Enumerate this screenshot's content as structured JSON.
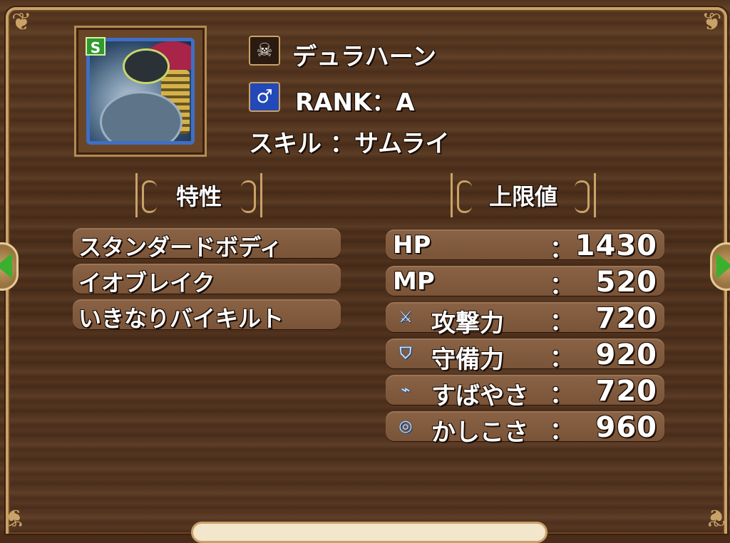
{
  "monster": {
    "name": "デュラハーン",
    "name_icon": "skull-icon",
    "rank_text": "RANK：A",
    "gender_icon": "male-symbol-icon",
    "gender_glyph": "♂",
    "skill_text": "スキル ：サムライ",
    "badge": "S"
  },
  "traits": {
    "header": "特性",
    "items": [
      "スタンダードボディ",
      "イオブレイク",
      "いきなりバイキルト"
    ]
  },
  "limits": {
    "header": "上限値",
    "colon": "：",
    "stats": [
      {
        "label": "HP",
        "value": "1430",
        "icon": null
      },
      {
        "label": "MP",
        "value": "520",
        "icon": null
      },
      {
        "label": "攻撃力",
        "value": "720",
        "icon": "sword-icon"
      },
      {
        "label": "守備力",
        "value": "920",
        "icon": "shield-icon"
      },
      {
        "label": "すばやさ",
        "value": "720",
        "icon": "boot-icon"
      },
      {
        "label": "かしこさ",
        "value": "960",
        "icon": "necklace-icon"
      }
    ]
  },
  "colors": {
    "accent_gold": "#c9a268",
    "wood": "#4f311c",
    "badge_green": "#2f9a2f",
    "gender_blue": "#2348b8"
  }
}
